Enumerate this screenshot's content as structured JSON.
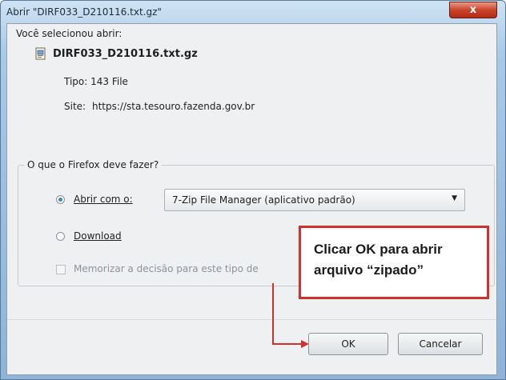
{
  "window": {
    "title": "Abrir \"DIRF033_D210116.txt.gz\"",
    "close_label": "x"
  },
  "dialog": {
    "intro": "Você selecionou abrir:",
    "file_name": "DIRF033_D210116.txt.gz",
    "type_line": "Tipo: 143 File",
    "site_label": "Site:",
    "site_url": "https://sta.tesouro.fazenda.gov.br",
    "group_title": "O que o Firefox deve fazer?",
    "open_with_label": "Abrir com o:",
    "open_with_value": "7-Zip File Manager (aplicativo padrão)",
    "download_label": "Download",
    "remember_label": "Memorizar a decisão para este tipo de",
    "selected_option": "open_with",
    "remember_checked": false
  },
  "buttons": {
    "ok": "OK",
    "cancel": "Cancelar"
  },
  "annotation": {
    "text": "Clicar OK para abrir arquivo “zipado”",
    "color": "#d1312c"
  }
}
